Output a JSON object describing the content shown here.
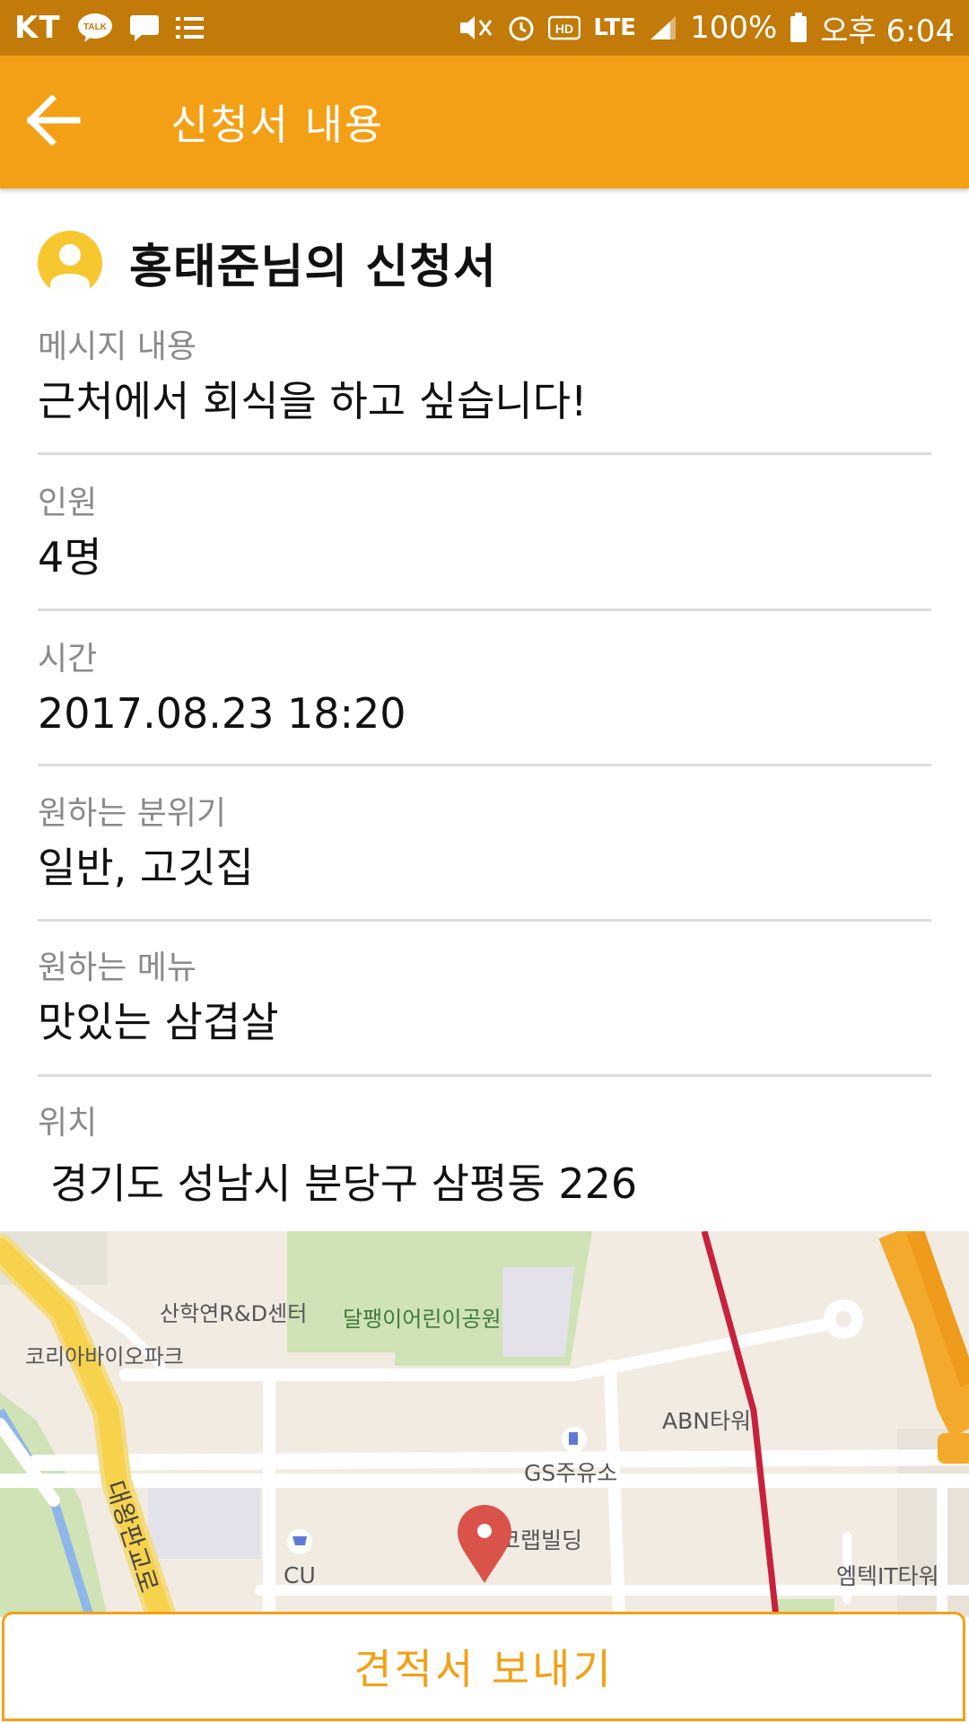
{
  "status_bar": {
    "carrier": "KT",
    "talk_badge": "TALK",
    "network": "LTE",
    "battery": "100%",
    "time": "오후 6:04"
  },
  "appbar": {
    "title": "신청서 내용"
  },
  "header": {
    "title": "홍태준님의 신청서"
  },
  "fields": [
    {
      "label": "메시지 내용",
      "value": "근처에서 회식을 하고 싶습니다!"
    },
    {
      "label": "인원",
      "value": "4명"
    },
    {
      "label": "시간",
      "value": "2017.08.23 18:20"
    },
    {
      "label": "원하는 분위기",
      "value": "일반, 고깃집"
    },
    {
      "label": "원하는 메뉴",
      "value": "맛있는 삼겹살"
    },
    {
      "label": "위치",
      "value": "경기도 성남시 분당구 삼평동 226"
    }
  ],
  "map": {
    "labels": {
      "rnd_center": "산학연R&D센터",
      "park": "달팽이어린이공원",
      "bio_park": "코리아바이오파크",
      "abn_tower": "ABN타워",
      "gs_station": "GS주유소",
      "eco_lab": "에코랩빌딩",
      "cu": "CU",
      "emtek": "엠텍IT타워",
      "road": "대왕판교로"
    }
  },
  "bottom": {
    "send_label": "견적서 보내기"
  },
  "colors": {
    "status_bar": "#c27a08",
    "appbar": "#f4a016",
    "avatar": "#f7c72f",
    "pin": "#d9534a"
  }
}
